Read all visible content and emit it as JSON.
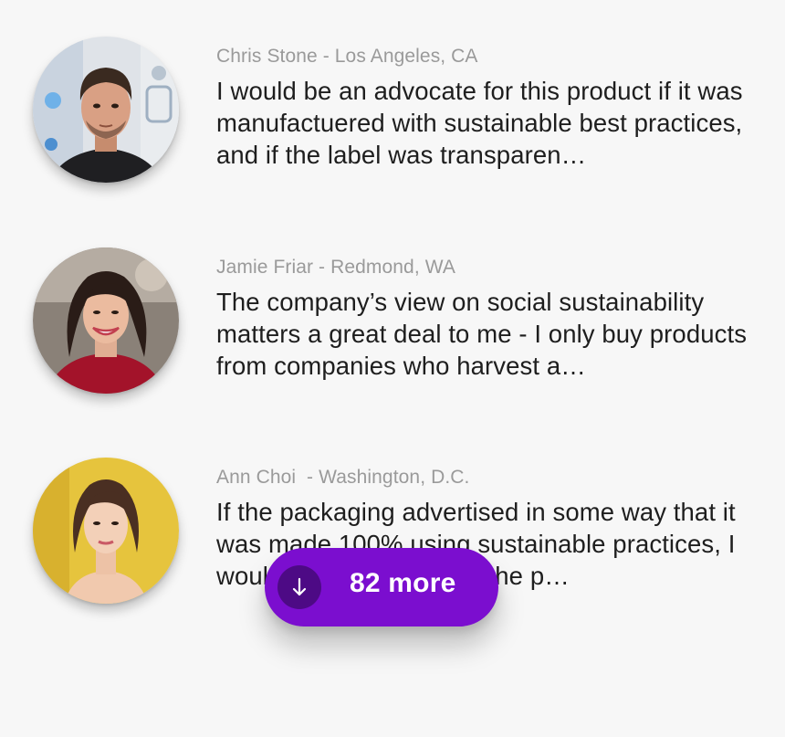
{
  "reviews": [
    {
      "author": "Chris Stone - Los Angeles, CA",
      "quote": "I would be an advocate for this product if it was manufactuered with sustainable best practices, and if the label was transparen…",
      "avatar_icon": "man-portrait-avatar"
    },
    {
      "author": "Jamie Friar - Redmond, WA",
      "quote": "The company’s view on social sustainability matters a great deal to me - I only buy products from companies who harvest a…",
      "avatar_icon": "woman-portrait-avatar"
    },
    {
      "author": "Ann Choi  - Washington, D.C.",
      "quote": "If the packaging advertised in some way that it was made 100% using sustainable practices, I wouldn’t hesitate to buy the p…",
      "avatar_icon": "woman-portrait-avatar"
    }
  ],
  "more_button": {
    "label": "82 more",
    "icon": "arrow-down-icon",
    "color": "#7b0ecf",
    "icon_bg": "#4d0a85"
  },
  "colors": {
    "background": "#f7f7f7",
    "author_text": "#9a9a9a",
    "quote_text": "#1e1e1e"
  }
}
